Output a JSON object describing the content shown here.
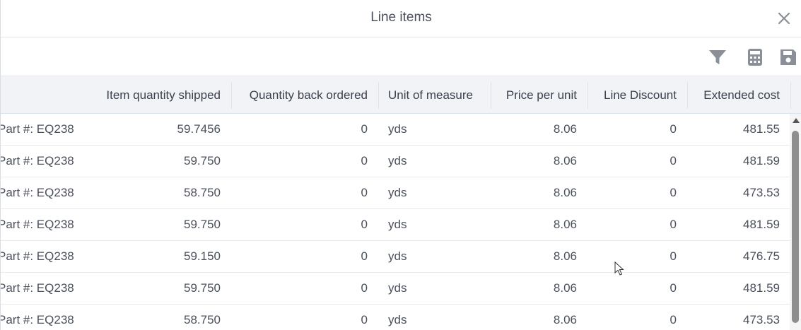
{
  "dialog": {
    "title": "Line items"
  },
  "toolbar": {
    "icons": [
      "filter-icon",
      "calculator-icon",
      "save-icon"
    ]
  },
  "table": {
    "columns": [
      "Item quantity shipped",
      "Quantity back ordered",
      "Unit of measure",
      "Price per unit",
      "Line Discount",
      "Extended cost"
    ],
    "rows": [
      {
        "part": "Part #: EQ238",
        "shipped": "59.7456",
        "back_ordered": "0",
        "uom": "yds",
        "price": "8.06",
        "discount": "0",
        "extended": "481.55"
      },
      {
        "part": "Part #: EQ238",
        "shipped": "59.750",
        "back_ordered": "0",
        "uom": "yds",
        "price": "8.06",
        "discount": "0",
        "extended": "481.59"
      },
      {
        "part": "Part #: EQ238",
        "shipped": "58.750",
        "back_ordered": "0",
        "uom": "yds",
        "price": "8.06",
        "discount": "0",
        "extended": "473.53"
      },
      {
        "part": "Part #: EQ238",
        "shipped": "59.750",
        "back_ordered": "0",
        "uom": "yds",
        "price": "8.06",
        "discount": "0",
        "extended": "481.59"
      },
      {
        "part": "Part #: EQ238",
        "shipped": "59.150",
        "back_ordered": "0",
        "uom": "yds",
        "price": "8.06",
        "discount": "0",
        "extended": "476.75"
      },
      {
        "part": "Part #: EQ238",
        "shipped": "59.750",
        "back_ordered": "0",
        "uom": "yds",
        "price": "8.06",
        "discount": "0",
        "extended": "481.59"
      },
      {
        "part": "Part #: EQ238",
        "shipped": "58.750",
        "back_ordered": "0",
        "uom": "yds",
        "price": "8.06",
        "discount": "0",
        "extended": "473.53"
      }
    ]
  },
  "colors": {
    "icon": "#8a8f98",
    "header_bg": "#f1f3f6",
    "header_border_accent": "#cfe6f5"
  }
}
